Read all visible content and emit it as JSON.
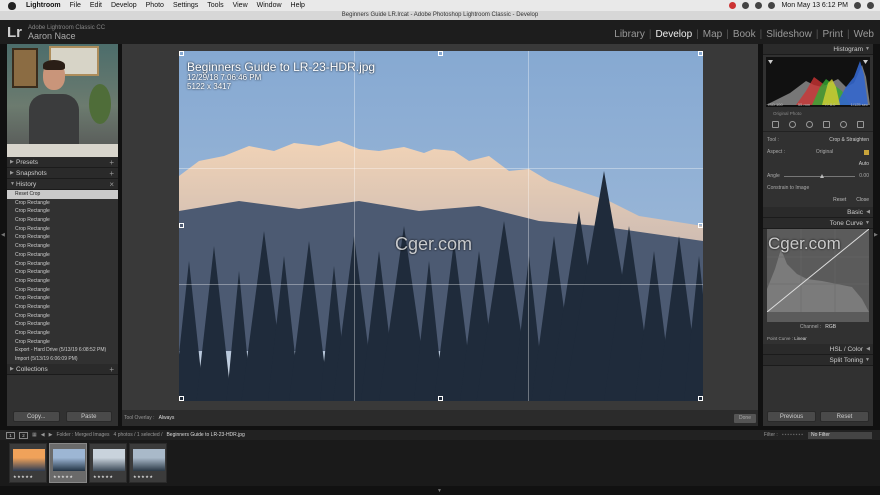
{
  "mac_menu": {
    "app": "Lightroom",
    "items": [
      "File",
      "Edit",
      "Develop",
      "Photo",
      "Settings",
      "Tools",
      "View",
      "Window",
      "Help"
    ],
    "clock": "Mon May 13 6:12 PM"
  },
  "window_title": "Beginners Guide LR.lrcat - Adobe Photoshop Lightroom Classic - Develop",
  "identity": {
    "logo": "Lr",
    "product": "Adobe Lightroom Classic CC",
    "user": "Aaron Nace"
  },
  "modules": [
    "Library",
    "Develop",
    "Map",
    "Book",
    "Slideshow",
    "Print",
    "Web"
  ],
  "active_module": "Develop",
  "left_panel": {
    "presets_label": "Presets",
    "snapshots_label": "Snapshots",
    "history_label": "History",
    "history": [
      "Reset Crop",
      "Crop Rectangle",
      "Crop Rectangle",
      "Crop Rectangle",
      "Crop Rectangle",
      "Crop Rectangle",
      "Crop Rectangle",
      "Crop Rectangle",
      "Crop Rectangle",
      "Crop Rectangle",
      "Crop Rectangle",
      "Crop Rectangle",
      "Crop Rectangle",
      "Crop Rectangle",
      "Crop Rectangle",
      "Crop Rectangle",
      "Crop Rectangle",
      "Crop Rectangle",
      "Export - Hard Drive (5/13/19 6:08:52 PM)",
      "Import (5/13/19 6:06:09 PM)"
    ],
    "collections_label": "Collections",
    "copy_label": "Copy...",
    "paste_label": "Paste"
  },
  "photo_info": {
    "filename": "Beginners Guide to LR-23-HDR.jpg",
    "datetime": "12/29/18 7:06:46 PM",
    "dimensions": "5122 x 3417"
  },
  "toolbar": {
    "overlay_label": "Tool Overlay :",
    "overlay_value": "Always",
    "done_label": "Done"
  },
  "right_panel": {
    "histogram_label": "Histogram",
    "histo_meta": [
      "ISO 100",
      "55 mm",
      "f / 8.0",
      "1/125 sec"
    ],
    "original_photo": "Original Photo",
    "tool_label": "Tool :",
    "crop_straighten": "Crop & Straighten",
    "aspect_label": "Aspect :",
    "aspect_value": "Original",
    "auto_label": "Auto",
    "angle_label": "Angle",
    "angle_value": "0.00",
    "constrain_label": "Constrain to Image",
    "reset_label": "Reset",
    "close_label": "Close",
    "basic_label": "Basic",
    "tone_curve_label": "Tone Curve",
    "channel_label": "Channel :",
    "channel_value": "RGB",
    "point_curve_label": "Point Curve :",
    "point_curve_value": "Linear",
    "hsl_label": "HSL / Color",
    "split_toning_label": "Split Toning",
    "previous_label": "Previous",
    "reset_button": "Reset"
  },
  "filmstrip_bar": {
    "source": "Folder : Merged Images",
    "count": "4 photos / 1 selected /",
    "path": "Beginners Guide to LR-23-HDR.jpg",
    "filter_label": "Filter :",
    "filter_value": "No Filter"
  },
  "thumbnails": [
    {
      "stars": "★★★★★",
      "selected": false,
      "colors": [
        "#f0a25a",
        "#2d3c55"
      ]
    },
    {
      "stars": "★★★★★",
      "selected": true,
      "colors": [
        "#9db6d4",
        "#223344"
      ]
    },
    {
      "stars": "★★★★★",
      "selected": false,
      "colors": [
        "#c9d3dc",
        "#3c4a58"
      ]
    },
    {
      "stars": "★★★★★",
      "selected": false,
      "colors": [
        "#a9b9c9",
        "#2a3845"
      ]
    }
  ],
  "watermark": "Cger.com",
  "colors": {
    "accent": "#d6d6d6",
    "panel_bg": "#313131",
    "crop_lock": "#c9a43a"
  }
}
